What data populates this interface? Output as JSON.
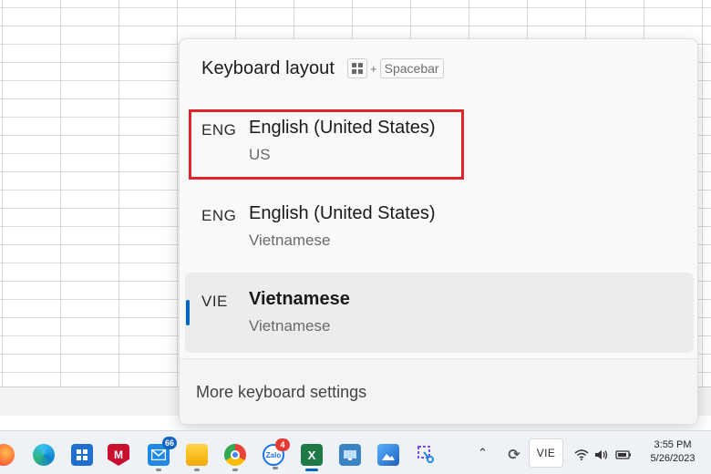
{
  "flyout": {
    "title": "Keyboard layout",
    "shortcut_plus": "+",
    "shortcut_key": "Spacebar",
    "items": [
      {
        "code": "ENG",
        "name": "English (United States)",
        "sub": "US",
        "selected": false,
        "highlighted": true
      },
      {
        "code": "ENG",
        "name": "English (United States)",
        "sub": "Vietnamese",
        "selected": false,
        "highlighted": false
      },
      {
        "code": "VIE",
        "name": "Vietnamese",
        "sub": "Vietnamese",
        "selected": true,
        "highlighted": false
      }
    ],
    "footer_link": "More keyboard settings"
  },
  "taskbar": {
    "apps": [
      {
        "name": "firefox-icon",
        "color": "#ff7139"
      },
      {
        "name": "edge-icon",
        "color": "#0f7fcf"
      },
      {
        "name": "store-icon",
        "color": "#1f6fd1"
      },
      {
        "name": "mcafee-icon",
        "color": "#c8102e",
        "glyph": "M"
      },
      {
        "name": "mail-icon",
        "color": "#1e88e5",
        "badge": "66"
      },
      {
        "name": "file-explorer-icon",
        "color": "#f5b800"
      },
      {
        "name": "chrome-icon",
        "color": "#34a853"
      },
      {
        "name": "zalo-icon",
        "color": "#1a73e8",
        "badge": "4"
      },
      {
        "name": "excel-icon",
        "color": "#1d7a45",
        "glyph": "X"
      },
      {
        "name": "remote-desktop-icon",
        "color": "#3b82c4"
      },
      {
        "name": "photos-icon",
        "color": "#2f7fd6"
      },
      {
        "name": "snipping-tool-icon",
        "color": "#8b5cf6"
      }
    ],
    "tray": {
      "language": "VIE",
      "time": "3:55 PM",
      "date": "5/26/2023"
    }
  }
}
